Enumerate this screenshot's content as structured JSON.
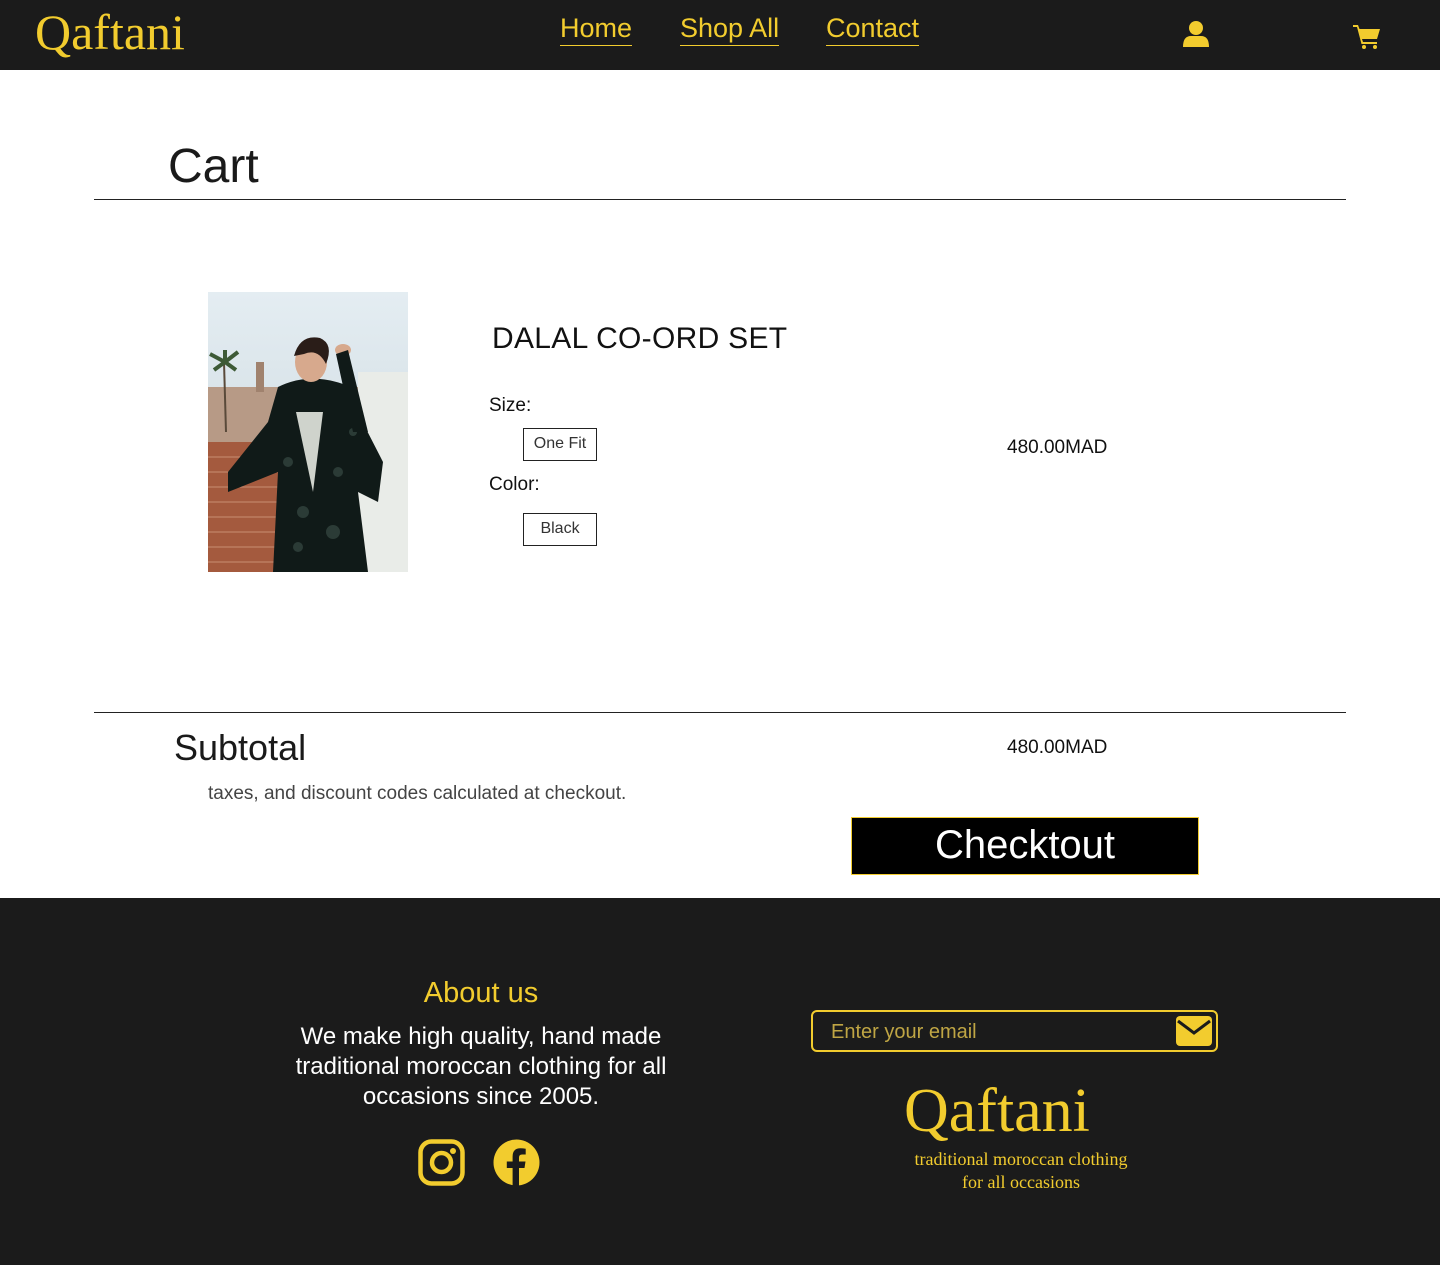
{
  "header": {
    "logo": "Qaftani",
    "nav": {
      "home": "Home",
      "shop_all": "Shop All",
      "contact": "Contact"
    },
    "icons": {
      "account": "user-icon",
      "cart": "shopping-cart-icon"
    },
    "accent_color": "#f2cc2e",
    "background_color": "#1b1b1b"
  },
  "cart": {
    "title": "Cart",
    "item": {
      "name": "DALAL CO-ORD SET",
      "size_label": "Size:",
      "size_value": "One Fit",
      "color_label": "Color:",
      "color_value": "Black",
      "price": "480.00MAD"
    },
    "subtotal_label": "Subtotal",
    "subtotal_value": "480.00MAD",
    "tax_note": "taxes, and discount codes calculated at checkout.",
    "checkout_label": "Checktout"
  },
  "footer": {
    "about_title": "About us",
    "about_text": "We make high quality, hand made traditional moroccan clothing for all occasions since 2005.",
    "social_icons": [
      "instagram-icon",
      "facebook-icon"
    ],
    "email_placeholder": "Enter your email",
    "email_icon": "envelope-icon",
    "logo": "Qaftani",
    "tagline_line1": "traditional moroccan clothing",
    "tagline_line2": "for all occasions"
  }
}
